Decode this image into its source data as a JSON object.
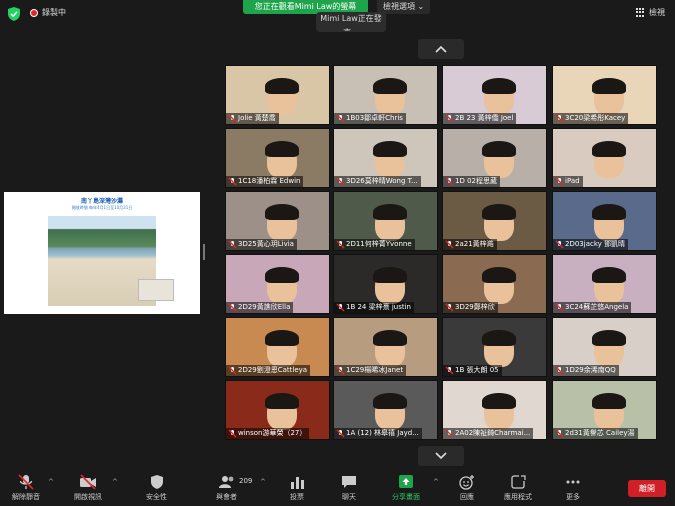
{
  "topbar": {
    "recording_label": "錄製中",
    "viewing_label": "您正在觀看Mimi Law的螢幕",
    "view_options_label": "檢視選項",
    "speaking_label": "Mimi Law正在發言...",
    "gallery_label": "檢視"
  },
  "shared_screen": {
    "title": "南丫島深灣沙灘",
    "subtitle": "開放時間 每年4月1日至10月31日"
  },
  "participants": [
    {
      "name": "Jolie 黃楚喬",
      "bg": "#d9c6a6",
      "muted": true
    },
    {
      "name": "1B03鄒卓軒Chris",
      "bg": "#c9c0b5",
      "muted": true
    },
    {
      "name": "2B 23 黃梓僑 Joel",
      "bg": "#d8cbd5",
      "muted": true
    },
    {
      "name": "3C20梁希彤Kacey",
      "bg": "#e9d6b9",
      "muted": true
    },
    {
      "name": "1C18潘柏霖 Edwin",
      "bg": "#8c7b64",
      "muted": true
    },
    {
      "name": "3D26莫梓晴Wong T...",
      "bg": "#cfc6bb",
      "muted": true
    },
    {
      "name": "1D 02程思葳",
      "bg": "#b8b0a8",
      "muted": true
    },
    {
      "name": "iPad",
      "bg": "#d9cbc0",
      "muted": true
    },
    {
      "name": "3D25黃心玥Livia",
      "bg": "#9c9088",
      "muted": true
    },
    {
      "name": "2D11何梓菁Yvonne",
      "bg": "#505a4a",
      "muted": true
    },
    {
      "name": "2a21黃梓澔",
      "bg": "#6b5a44",
      "muted": true
    },
    {
      "name": "2D03jacky 鄧凱晴",
      "bg": "#5a6a8a",
      "muted": true
    },
    {
      "name": "2D29黃譙欣Ella",
      "bg": "#c8a8b8",
      "muted": true
    },
    {
      "name": "1B 24 梁梓熹 justin",
      "bg": "#2c2a28",
      "muted": true
    },
    {
      "name": "3D29鄭梓欣",
      "bg": "#8a6a50",
      "muted": true
    },
    {
      "name": "3C24蘇芷悠Angela",
      "bg": "#c8b0c0",
      "muted": true
    },
    {
      "name": "2D29劉澄恩Cattleya",
      "bg": "#c88a50",
      "muted": true
    },
    {
      "name": "1C29楊晞冰Janet",
      "bg": "#b89c80",
      "muted": true
    },
    {
      "name": "1B 張大朗 05",
      "bg": "#3a3a3a",
      "muted": true
    },
    {
      "name": "1D29余浠南QQ",
      "bg": "#d8d0c8",
      "muted": true
    },
    {
      "name": "winson游華榮（27）",
      "bg": "#8a2a1a",
      "muted": true
    },
    {
      "name": "1A (12) 林皋禧 Jayd...",
      "bg": "#5a5a5a",
      "muted": true
    },
    {
      "name": "2A02陳祉錡Charmai...",
      "bg": "#e0d8d0",
      "muted": true
    },
    {
      "name": "2d31黃譽芯 Cailey湯",
      "bg": "#b8c0a8",
      "muted": true
    }
  ],
  "toolbar": {
    "unmute_label": "解除靜音",
    "video_label": "開啟視訊",
    "security_label": "安全性",
    "participants_label": "與會者",
    "participants_count": "209",
    "polls_label": "投票",
    "chat_label": "聊天",
    "share_label": "分享畫面",
    "reactions_label": "回應",
    "apps_label": "應用程式",
    "more_label": "更多",
    "leave_label": "離開"
  }
}
